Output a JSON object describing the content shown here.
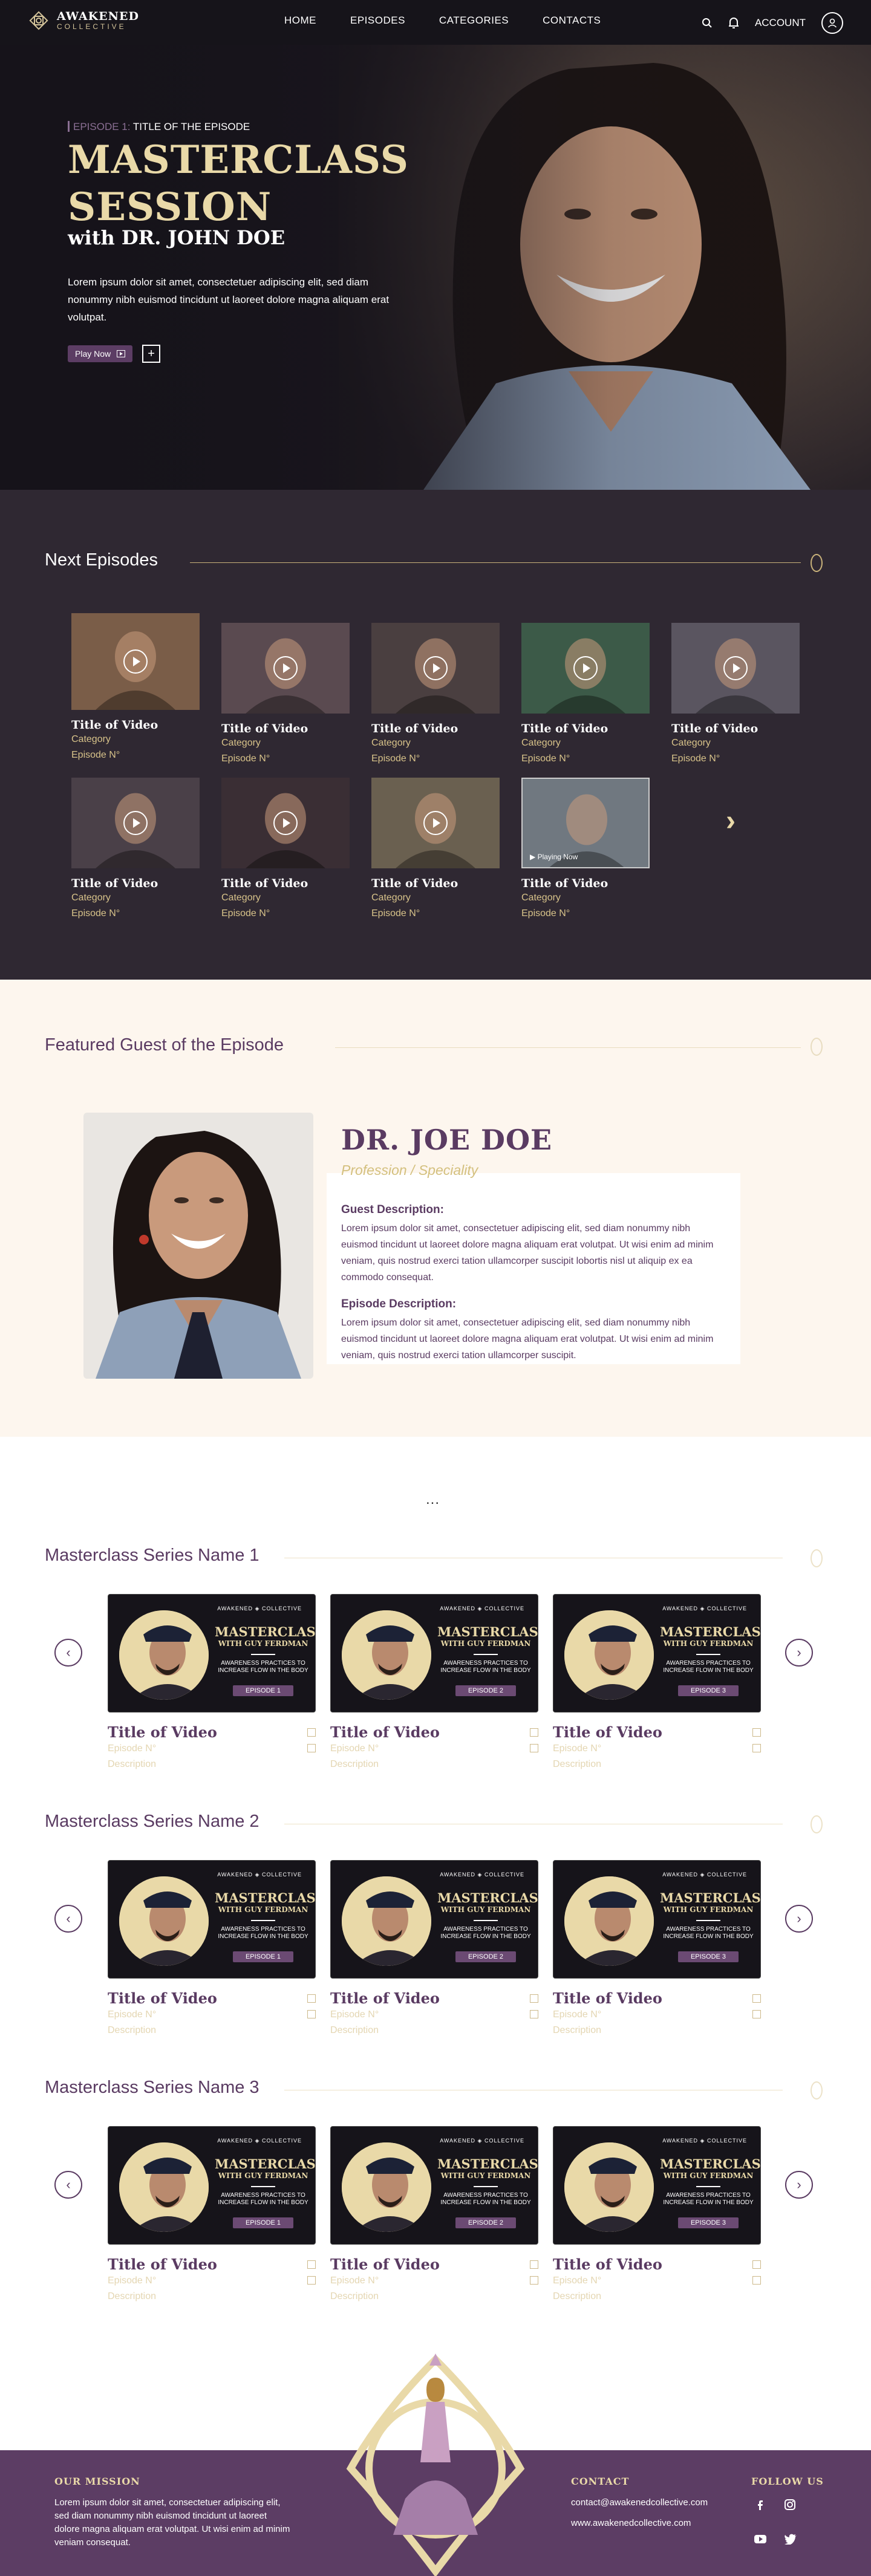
{
  "nav": {
    "logo_title": "AWAKENED",
    "logo_sub": "COLLECTIVE",
    "menu": [
      "HOME",
      "EPISODES",
      "CATEGORIES",
      "CONTACTS"
    ],
    "account": "ACCOUNT"
  },
  "hero": {
    "kicker_ep": "EPISODE 1:",
    "kicker_text": "TITLE OF THE EPISODE",
    "title_line1": "MASTERCLASS",
    "title_line2": "SESSION",
    "subtitle": "with DR. JOHN DOE",
    "description": "Lorem ipsum dolor sit amet, consectetuer adipiscing elit, sed diam nonummy nibh euismod tincidunt ut laoreet dolore magna aliquam erat volutpat.",
    "play_label": "Play Now"
  },
  "next_episodes": {
    "title": "Next Episodes",
    "playing_now": "Playing Now",
    "items": [
      {
        "title": "Title of Video",
        "category": "Category",
        "episode": "Episode N°"
      },
      {
        "title": "Title of Video",
        "category": "Category",
        "episode": "Episode N°"
      },
      {
        "title": "Title of Video",
        "category": "Category",
        "episode": "Episode N°"
      },
      {
        "title": "Title of Video",
        "category": "Category",
        "episode": "Episode N°"
      },
      {
        "title": "Title of Video",
        "category": "Category",
        "episode": "Episode N°"
      },
      {
        "title": "Title of Video",
        "category": "Category",
        "episode": "Episode N°"
      },
      {
        "title": "Title of Video",
        "category": "Category",
        "episode": "Episode N°"
      },
      {
        "title": "Title of Video",
        "category": "Category",
        "episode": "Episode N°"
      },
      {
        "title": "Title of Video",
        "category": "Category",
        "episode": "Episode N°"
      }
    ]
  },
  "featured": {
    "title": "Featured Guest of the Episode",
    "name": "DR. JOE DOE",
    "profession": "Profession / Speciality",
    "guest_heading": "Guest Description:",
    "guest_text": "Lorem ipsum dolor sit amet, consectetuer adipiscing elit, sed diam nonummy nibh euismod tincidunt ut laoreet dolore magna aliquam erat volutpat. Ut wisi enim ad minim veniam, quis nostrud exerci tation ullamcorper suscipit lobortis nisl ut aliquip ex ea commodo consequat.",
    "episode_heading": "Episode Description:",
    "episode_text": "Lorem ipsum dolor sit amet, consectetuer adipiscing elit, sed diam nonummy nibh euismod tincidunt ut laoreet dolore magna aliquam erat volutpat. Ut wisi enim ad minim veniam, quis nostrud exerci tation ullamcorper suscipit."
  },
  "more_dots": "...",
  "thumb": {
    "brand": "AWAKENED ◈ COLLECTIVE",
    "line1": "MASTERCLASS",
    "line2": "WITH GUY FERDMAN",
    "line3": "AWARENESS PRACTICES TO INCREASE FLOW IN THE BODY"
  },
  "series": [
    {
      "name": "Masterclass Series Name 1",
      "cards": [
        {
          "ep": "EPISODE 1",
          "title": "Title of Video",
          "episode": "Episode N°",
          "desc": "Description"
        },
        {
          "ep": "EPISODE 2",
          "title": "Title of Video",
          "episode": "Episode N°",
          "desc": "Description"
        },
        {
          "ep": "EPISODE 3",
          "title": "Title of Video",
          "episode": "Episode N°",
          "desc": "Description"
        }
      ]
    },
    {
      "name": "Masterclass Series Name 2",
      "cards": [
        {
          "ep": "EPISODE 1",
          "title": "Title of Video",
          "episode": "Episode N°",
          "desc": "Description"
        },
        {
          "ep": "EPISODE 2",
          "title": "Title of Video",
          "episode": "Episode N°",
          "desc": "Description"
        },
        {
          "ep": "EPISODE 3",
          "title": "Title of Video",
          "episode": "Episode N°",
          "desc": "Description"
        }
      ]
    },
    {
      "name": "Masterclass Series Name 3",
      "cards": [
        {
          "ep": "EPISODE 1",
          "title": "Title of Video",
          "episode": "Episode N°",
          "desc": "Description"
        },
        {
          "ep": "EPISODE 2",
          "title": "Title of Video",
          "episode": "Episode N°",
          "desc": "Description"
        },
        {
          "ep": "EPISODE 3",
          "title": "Title of Video",
          "episode": "Episode N°",
          "desc": "Description"
        }
      ]
    }
  ],
  "footer": {
    "mission_heading": "OUR MISSION",
    "mission_text": "Lorem ipsum dolor sit amet, consectetuer adipiscing elit, sed diam nonummy nibh euismod tincidunt ut laoreet dolore magna aliquam erat volutpat. Ut wisi enim ad minim veniam consequat.",
    "contact_heading": "CONTACT",
    "email": "contact@awakenedcollective.com",
    "website": "www.awakenedcollective.com",
    "follow_heading": "FOLLOW US"
  },
  "colors": {
    "accent_gold": "#e9d9a8",
    "brand_purple": "#5c3d64",
    "dark_bg": "#2f2832"
  }
}
